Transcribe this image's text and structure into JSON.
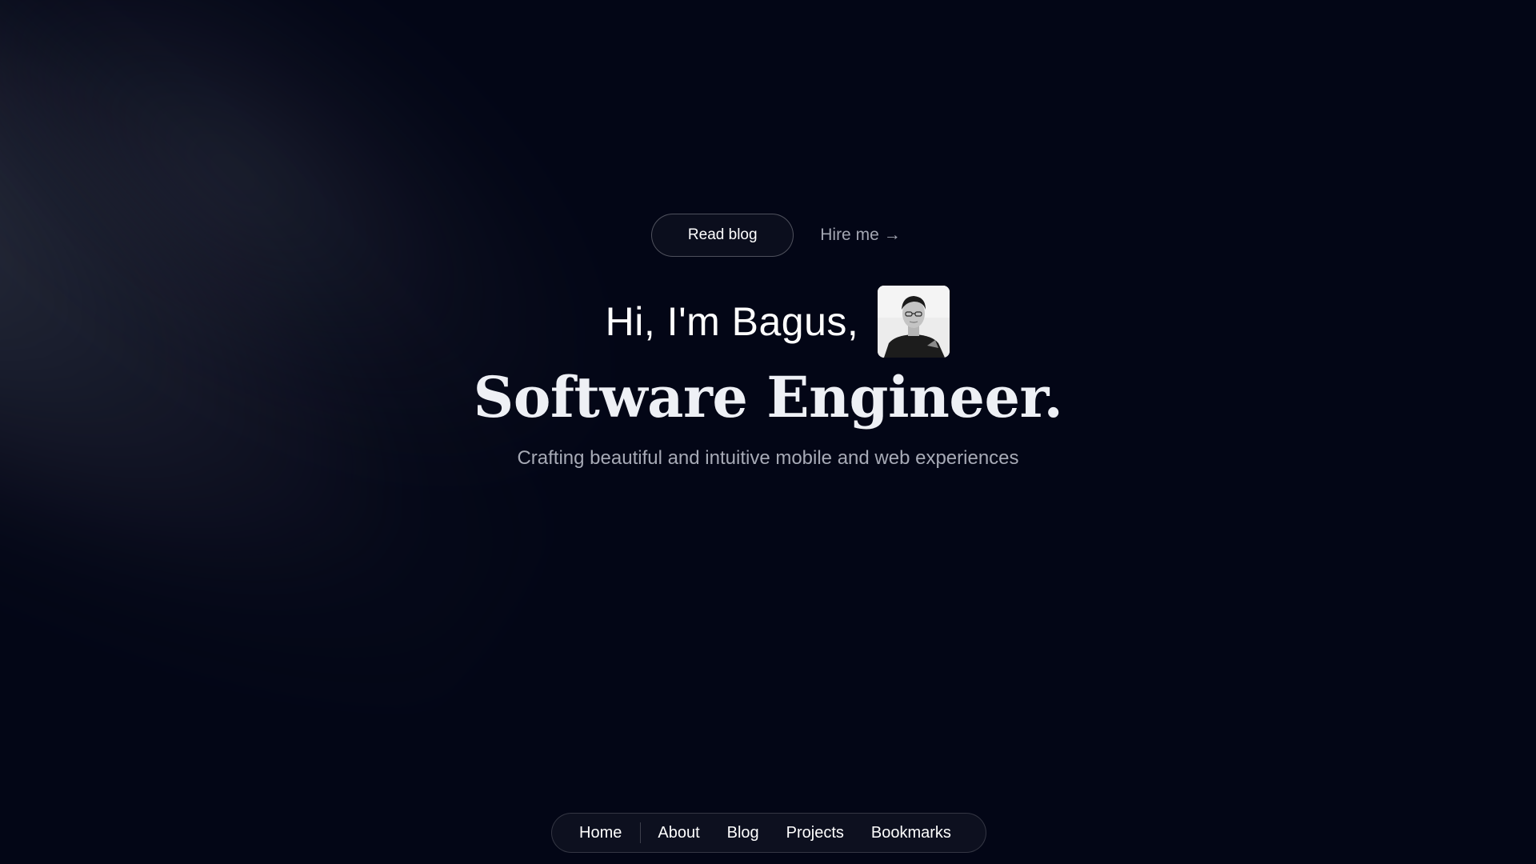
{
  "hero": {
    "read_blog_label": "Read blog",
    "hire_me_label": "Hire me",
    "hire_me_arrow": "→",
    "greeting": "Hi, I'm Bagus,",
    "title": "Software Engineer.",
    "subtitle": "Crafting beautiful and intuitive mobile and web experiences"
  },
  "nav": {
    "items": [
      {
        "label": "Home"
      },
      {
        "label": "About"
      },
      {
        "label": "Blog"
      },
      {
        "label": "Projects"
      },
      {
        "label": "Bookmarks"
      }
    ]
  },
  "icons": {
    "avatar": "profile-photo"
  },
  "colors": {
    "background": "#030616",
    "text_primary": "#ffffff",
    "text_muted": "#a7aab6"
  }
}
